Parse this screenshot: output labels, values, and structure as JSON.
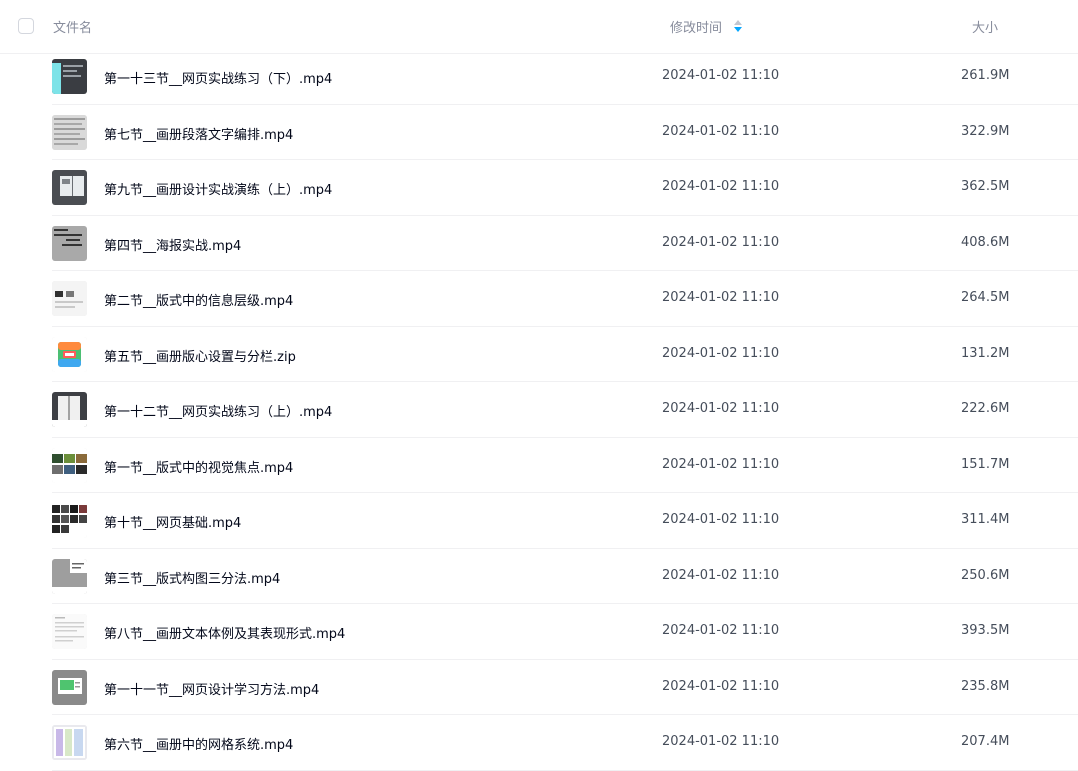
{
  "header": {
    "name_label": "文件名",
    "time_label": "修改时间",
    "size_label": "大小"
  },
  "colors": {
    "header_text": "#878c9c",
    "sort_active": "#06a7ff",
    "row_divider": "#f0f0f2"
  },
  "files": [
    {
      "name": "第一十三节__网页实战练习（下）.mp4",
      "time": "2024-01-02 11:10",
      "size": "261.9M",
      "thumb": "video-thumbnail"
    },
    {
      "name": "第七节__画册段落文字编排.mp4",
      "time": "2024-01-02 11:10",
      "size": "322.9M",
      "thumb": "video-thumbnail"
    },
    {
      "name": "第九节__画册设计实战演练（上）.mp4",
      "time": "2024-01-02 11:10",
      "size": "362.5M",
      "thumb": "video-thumbnail"
    },
    {
      "name": "第四节__海报实战.mp4",
      "time": "2024-01-02 11:10",
      "size": "408.6M",
      "thumb": "video-thumbnail"
    },
    {
      "name": "第二节__版式中的信息层级.mp4",
      "time": "2024-01-02 11:10",
      "size": "264.5M",
      "thumb": "video-thumbnail"
    },
    {
      "name": "第五节__画册版心设置与分栏.zip",
      "time": "2024-01-02 11:10",
      "size": "131.2M",
      "thumb": "zip-icon"
    },
    {
      "name": "第一十二节__网页实战练习（上）.mp4",
      "time": "2024-01-02 11:10",
      "size": "222.6M",
      "thumb": "video-thumbnail"
    },
    {
      "name": "第一节__版式中的视觉焦点.mp4",
      "time": "2024-01-02 11:10",
      "size": "151.7M",
      "thumb": "video-thumbnail"
    },
    {
      "name": "第十节__网页基础.mp4",
      "time": "2024-01-02 11:10",
      "size": "311.4M",
      "thumb": "video-thumbnail"
    },
    {
      "name": "第三节__版式构图三分法.mp4",
      "time": "2024-01-02 11:10",
      "size": "250.6M",
      "thumb": "video-thumbnail"
    },
    {
      "name": "第八节__画册文本体例及其表现形式.mp4",
      "time": "2024-01-02 11:10",
      "size": "393.5M",
      "thumb": "video-thumbnail"
    },
    {
      "name": "第一十一节__网页设计学习方法.mp4",
      "time": "2024-01-02 11:10",
      "size": "235.8M",
      "thumb": "video-thumbnail"
    },
    {
      "name": "第六节__画册中的网格系统.mp4",
      "time": "2024-01-02 11:10",
      "size": "207.4M",
      "thumb": "video-thumbnail"
    }
  ]
}
